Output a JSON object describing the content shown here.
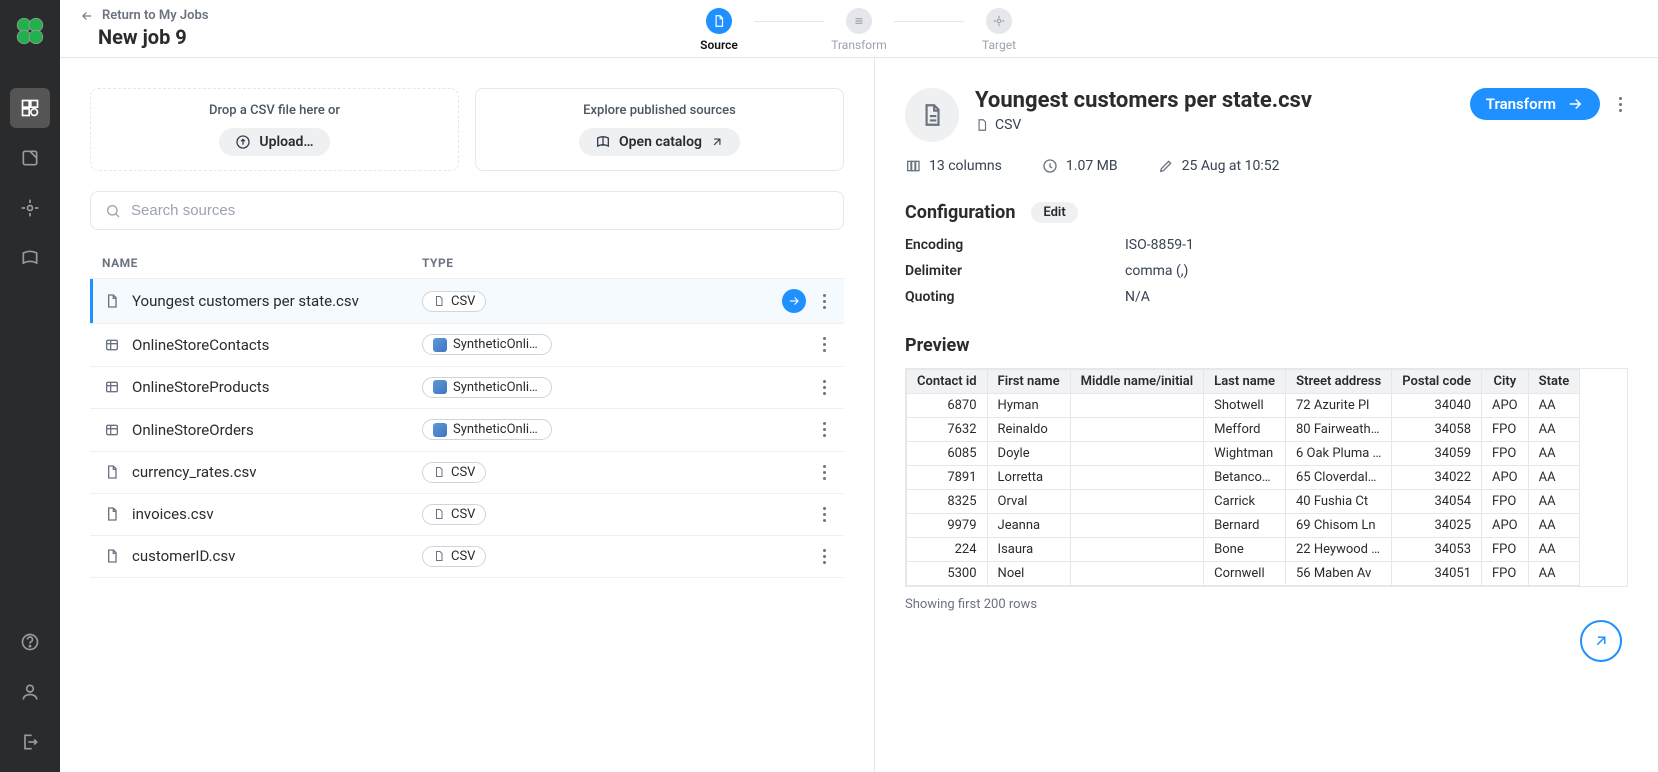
{
  "return_link": "Return to My Jobs",
  "job_title": "New job 9",
  "steps": [
    "Source",
    "Transform",
    "Target"
  ],
  "drop_hint": "Drop a CSV file here or",
  "upload_label": "Upload…",
  "explore_hint": "Explore published sources",
  "open_catalog_label": "Open catalog",
  "search_placeholder": "Search sources",
  "col_name": "NAME",
  "col_type": "TYPE",
  "sources": [
    {
      "name": "Youngest customers per state.csv",
      "type": "CSV",
      "icon": "file",
      "selected": true
    },
    {
      "name": "OnlineStoreContacts",
      "type": "SyntheticOnlin…",
      "icon": "db",
      "colored": true
    },
    {
      "name": "OnlineStoreProducts",
      "type": "SyntheticOnlin…",
      "icon": "db",
      "colored": true
    },
    {
      "name": "OnlineStoreOrders",
      "type": "SyntheticOnlin…",
      "icon": "db",
      "colored": true
    },
    {
      "name": "currency_rates.csv",
      "type": "CSV",
      "icon": "file"
    },
    {
      "name": "invoices.csv",
      "type": "CSV",
      "icon": "file"
    },
    {
      "name": "customerID.csv",
      "type": "CSV",
      "icon": "file"
    }
  ],
  "detail": {
    "title": "Youngest customers per state.csv",
    "type_label": "CSV",
    "transform_btn": "Transform",
    "columns": "13 columns",
    "size": "1.07 MB",
    "modified": "25 Aug at 10:52"
  },
  "config": {
    "title": "Configuration",
    "edit": "Edit",
    "rows": [
      {
        "k": "Encoding",
        "v": "ISO-8859-1"
      },
      {
        "k": "Delimiter",
        "v": "comma (,)"
      },
      {
        "k": "Quoting",
        "v": "N/A"
      }
    ]
  },
  "preview": {
    "title": "Preview",
    "headers": [
      "Contact id",
      "First name",
      "Middle name/initial",
      "Last name",
      "Street address",
      "Postal code",
      "City",
      "State"
    ],
    "numeric_cols": [
      0,
      5
    ],
    "rows": [
      [
        "6870",
        "Hyman",
        "",
        "Shotwell",
        "72 Azurite Pl",
        "34040",
        "APO",
        "AA"
      ],
      [
        "7632",
        "Reinaldo",
        "",
        "Mefford",
        "80 Fairweath…",
        "34058",
        "FPO",
        "AA"
      ],
      [
        "6085",
        "Doyle",
        "",
        "Wightman",
        "6 Oak Pluma …",
        "34059",
        "FPO",
        "AA"
      ],
      [
        "7891",
        "Lorretta",
        "",
        "Betanco…",
        "65 Cloverdal…",
        "34022",
        "APO",
        "AA"
      ],
      [
        "8325",
        "Orval",
        "",
        "Carrick",
        "40 Fushia Ct",
        "34054",
        "FPO",
        "AA"
      ],
      [
        "9979",
        "Jeanna",
        "",
        "Bernard",
        "69 Chisom Ln",
        "34025",
        "APO",
        "AA"
      ],
      [
        "224",
        "Isaura",
        "",
        "Bone",
        "22 Heywood …",
        "34053",
        "FPO",
        "AA"
      ],
      [
        "5300",
        "Noel",
        "",
        "Cornwell",
        "56 Maben Av",
        "34051",
        "FPO",
        "AA"
      ]
    ],
    "footnote": "Showing first 200 rows"
  }
}
